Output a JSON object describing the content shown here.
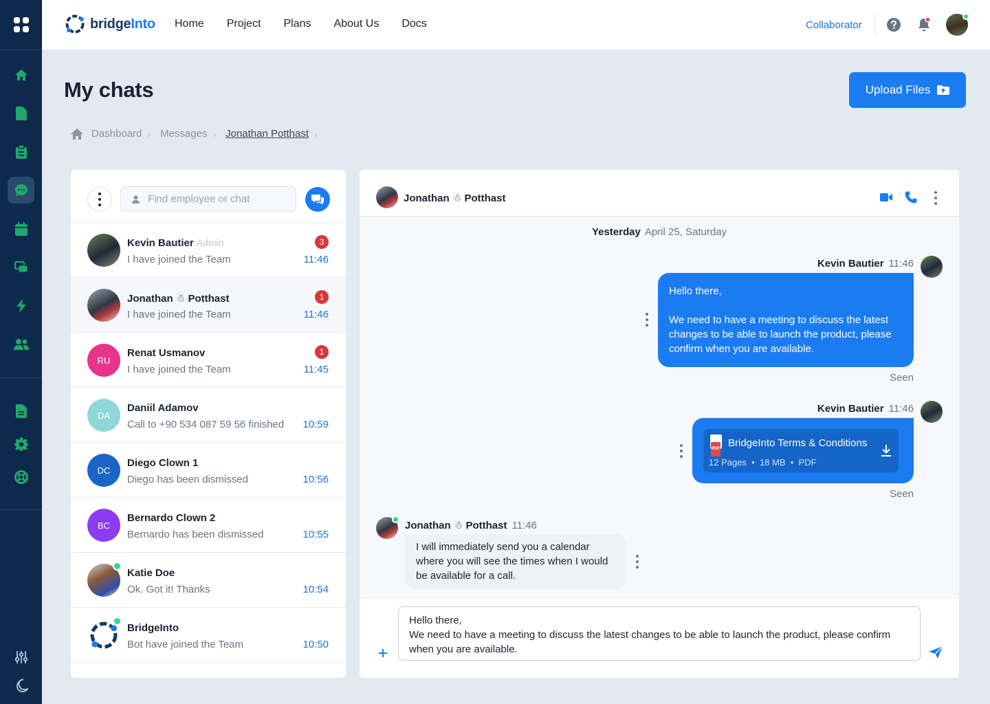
{
  "brand": {
    "name_main": "bridge",
    "name_accent": "Into"
  },
  "nav": [
    "Home",
    "Project",
    "Plans",
    "About Us",
    "Docs"
  ],
  "header": {
    "collaborator_label": "Collaborator"
  },
  "page": {
    "title": "My chats",
    "upload_label": "Upload Files"
  },
  "breadcrumb": [
    "Dashboard",
    "Messages",
    "Jonathan Potthast"
  ],
  "search": {
    "placeholder": "Find employee or chat"
  },
  "chats": [
    {
      "name": "Kevin Bautier",
      "role": "Admin",
      "preview": "I have joined the Team",
      "time": "11:46",
      "badge": "3",
      "avatar": "photo"
    },
    {
      "name": "Jonathan ☃ Potthast",
      "role": "",
      "preview": "I have joined the Team",
      "time": "11:46",
      "badge": "1",
      "avatar": "photo"
    },
    {
      "name": "Renat Usmanov",
      "role": "",
      "preview": "I have joined the Team",
      "time": "11:45",
      "badge": "1",
      "initials": "RU",
      "color": "#e8348a"
    },
    {
      "name": "Daniil Adamov",
      "role": "",
      "preview": "Call to +90 534 087 59 56 finished",
      "time": "10:59",
      "badge": "",
      "initials": "DA",
      "color": "#8fd7d9"
    },
    {
      "name": "Diego Clown 1",
      "role": "",
      "preview": "Diego has been dismissed",
      "time": "10:56",
      "badge": "",
      "initials": "DC",
      "color": "#1b64c8"
    },
    {
      "name": "Bernardo Clown 2",
      "role": "",
      "preview": "Bernardo has been dismissed",
      "time": "10:55",
      "badge": "",
      "initials": "BC",
      "color": "#8b3cf0"
    },
    {
      "name": "Katie Doe",
      "role": "",
      "preview": "Ok. Got it! Thanks",
      "time": "10:54",
      "badge": "",
      "avatar": "photo"
    },
    {
      "name": "BridgeInto",
      "role": "",
      "preview": "Bot have joined the Team",
      "time": "10:50",
      "badge": "",
      "avatar": "logo"
    }
  ],
  "conversation": {
    "contact": "Jonathan ☃ Potthast",
    "day_label": "Yesterday",
    "day_date": "April 25, Saturday",
    "messages": [
      {
        "sender": "Kevin Bautier",
        "time": "11:46",
        "greeting": "Hello there,",
        "body": "We need to have a meeting to discuss the latest changes to be able to launch the product, please confirm when you are available.",
        "status": "Seen"
      },
      {
        "sender": "Kevin Bautier",
        "time": "11:46",
        "file_name": "BridgeInto Terms & Conditions",
        "file_pages": "12 Pages",
        "file_size": "18 MB",
        "file_type": "PDF",
        "file_badge": "PDF",
        "status": "Seen"
      },
      {
        "sender": "Jonathan ☃ Potthast",
        "time": "11:46",
        "body": "I will immediately send you a calendar where you will see the times when I would be available for a call."
      }
    ],
    "draft": "Hello there,\nWe need to have a meeting to discuss the latest changes to be able to launch the product, please confirm when you are available."
  }
}
